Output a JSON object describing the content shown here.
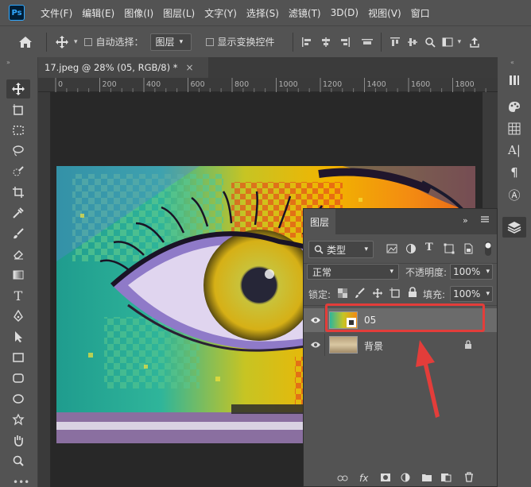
{
  "menubar": {
    "logo": "Ps",
    "items": [
      "文件(F)",
      "编辑(E)",
      "图像(I)",
      "图层(L)",
      "文字(Y)",
      "选择(S)",
      "滤镜(T)",
      "3D(D)",
      "视图(V)",
      "窗口"
    ]
  },
  "options_bar": {
    "auto_select_label": "自动选择：",
    "auto_select_value": "图层",
    "show_transform_label": "显示变换控件"
  },
  "document": {
    "tab_title": "17.jpeg @ 28% (05, RGB/8) *",
    "close_glyph": "×"
  },
  "ruler": {
    "labels": [
      "0",
      "200",
      "400",
      "600",
      "800",
      "1000",
      "1200",
      "1400",
      "1600",
      "1800"
    ]
  },
  "layers_panel": {
    "title": "图层",
    "filter_kind": "类型",
    "blend_mode": "正常",
    "opacity_label": "不透明度:",
    "opacity_value": "100%",
    "lock_label": "锁定:",
    "fill_label": "填充:",
    "fill_value": "100%",
    "layers": [
      {
        "name": "05",
        "selected": true,
        "visible": true
      },
      {
        "name": "背景",
        "selected": false,
        "visible": true,
        "locked": true
      }
    ],
    "footer_fx": "fx"
  },
  "colors": {
    "annotation_red": "#e33d3a",
    "selected_row": "#6b6b6b"
  }
}
